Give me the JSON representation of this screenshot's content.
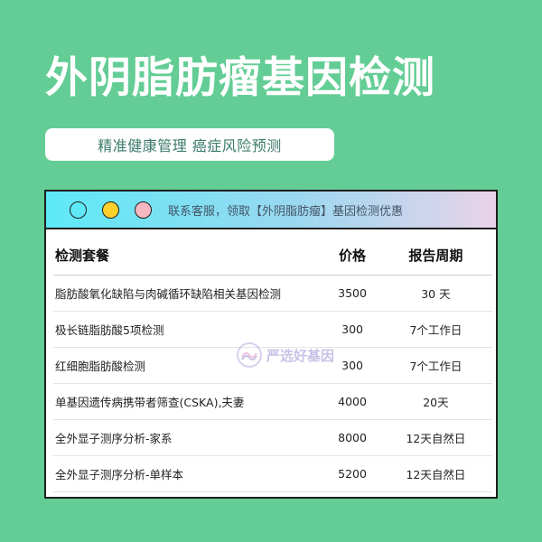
{
  "header": {
    "title": "外阴脂肪瘤基因检测",
    "subtitle": "精准健康管理 癌症风险预测"
  },
  "window": {
    "banner": "联系客服，领取【外阴脂肪瘤】基因检测优惠",
    "dots": [
      "#5de9f7",
      "#ffd02a",
      "#f6b7c0"
    ]
  },
  "table": {
    "headers": [
      "检测套餐",
      "价格",
      "报告周期"
    ],
    "rows": [
      [
        "脂肪酸氧化缺陷与肉碱循环缺陷相关基因检测",
        "3500",
        "30 天"
      ],
      [
        "极长链脂肪酸5项检测",
        "300",
        "7个工作日"
      ],
      [
        "红细胞脂肪酸检测",
        "300",
        "7个工作日"
      ],
      [
        "单基因遗传病携带者筛查(CSKA),夫妻",
        "4000",
        "20天"
      ],
      [
        "全外显子测序分析-家系",
        "8000",
        "12天自然日"
      ],
      [
        "全外显子测序分析-单样本",
        "5200",
        "12天自然日"
      ]
    ]
  },
  "watermark": {
    "text": "严选好基因"
  },
  "colors": {
    "background": "#63cd95",
    "title": "#ffffff",
    "window_border": "#1e1e1e"
  }
}
